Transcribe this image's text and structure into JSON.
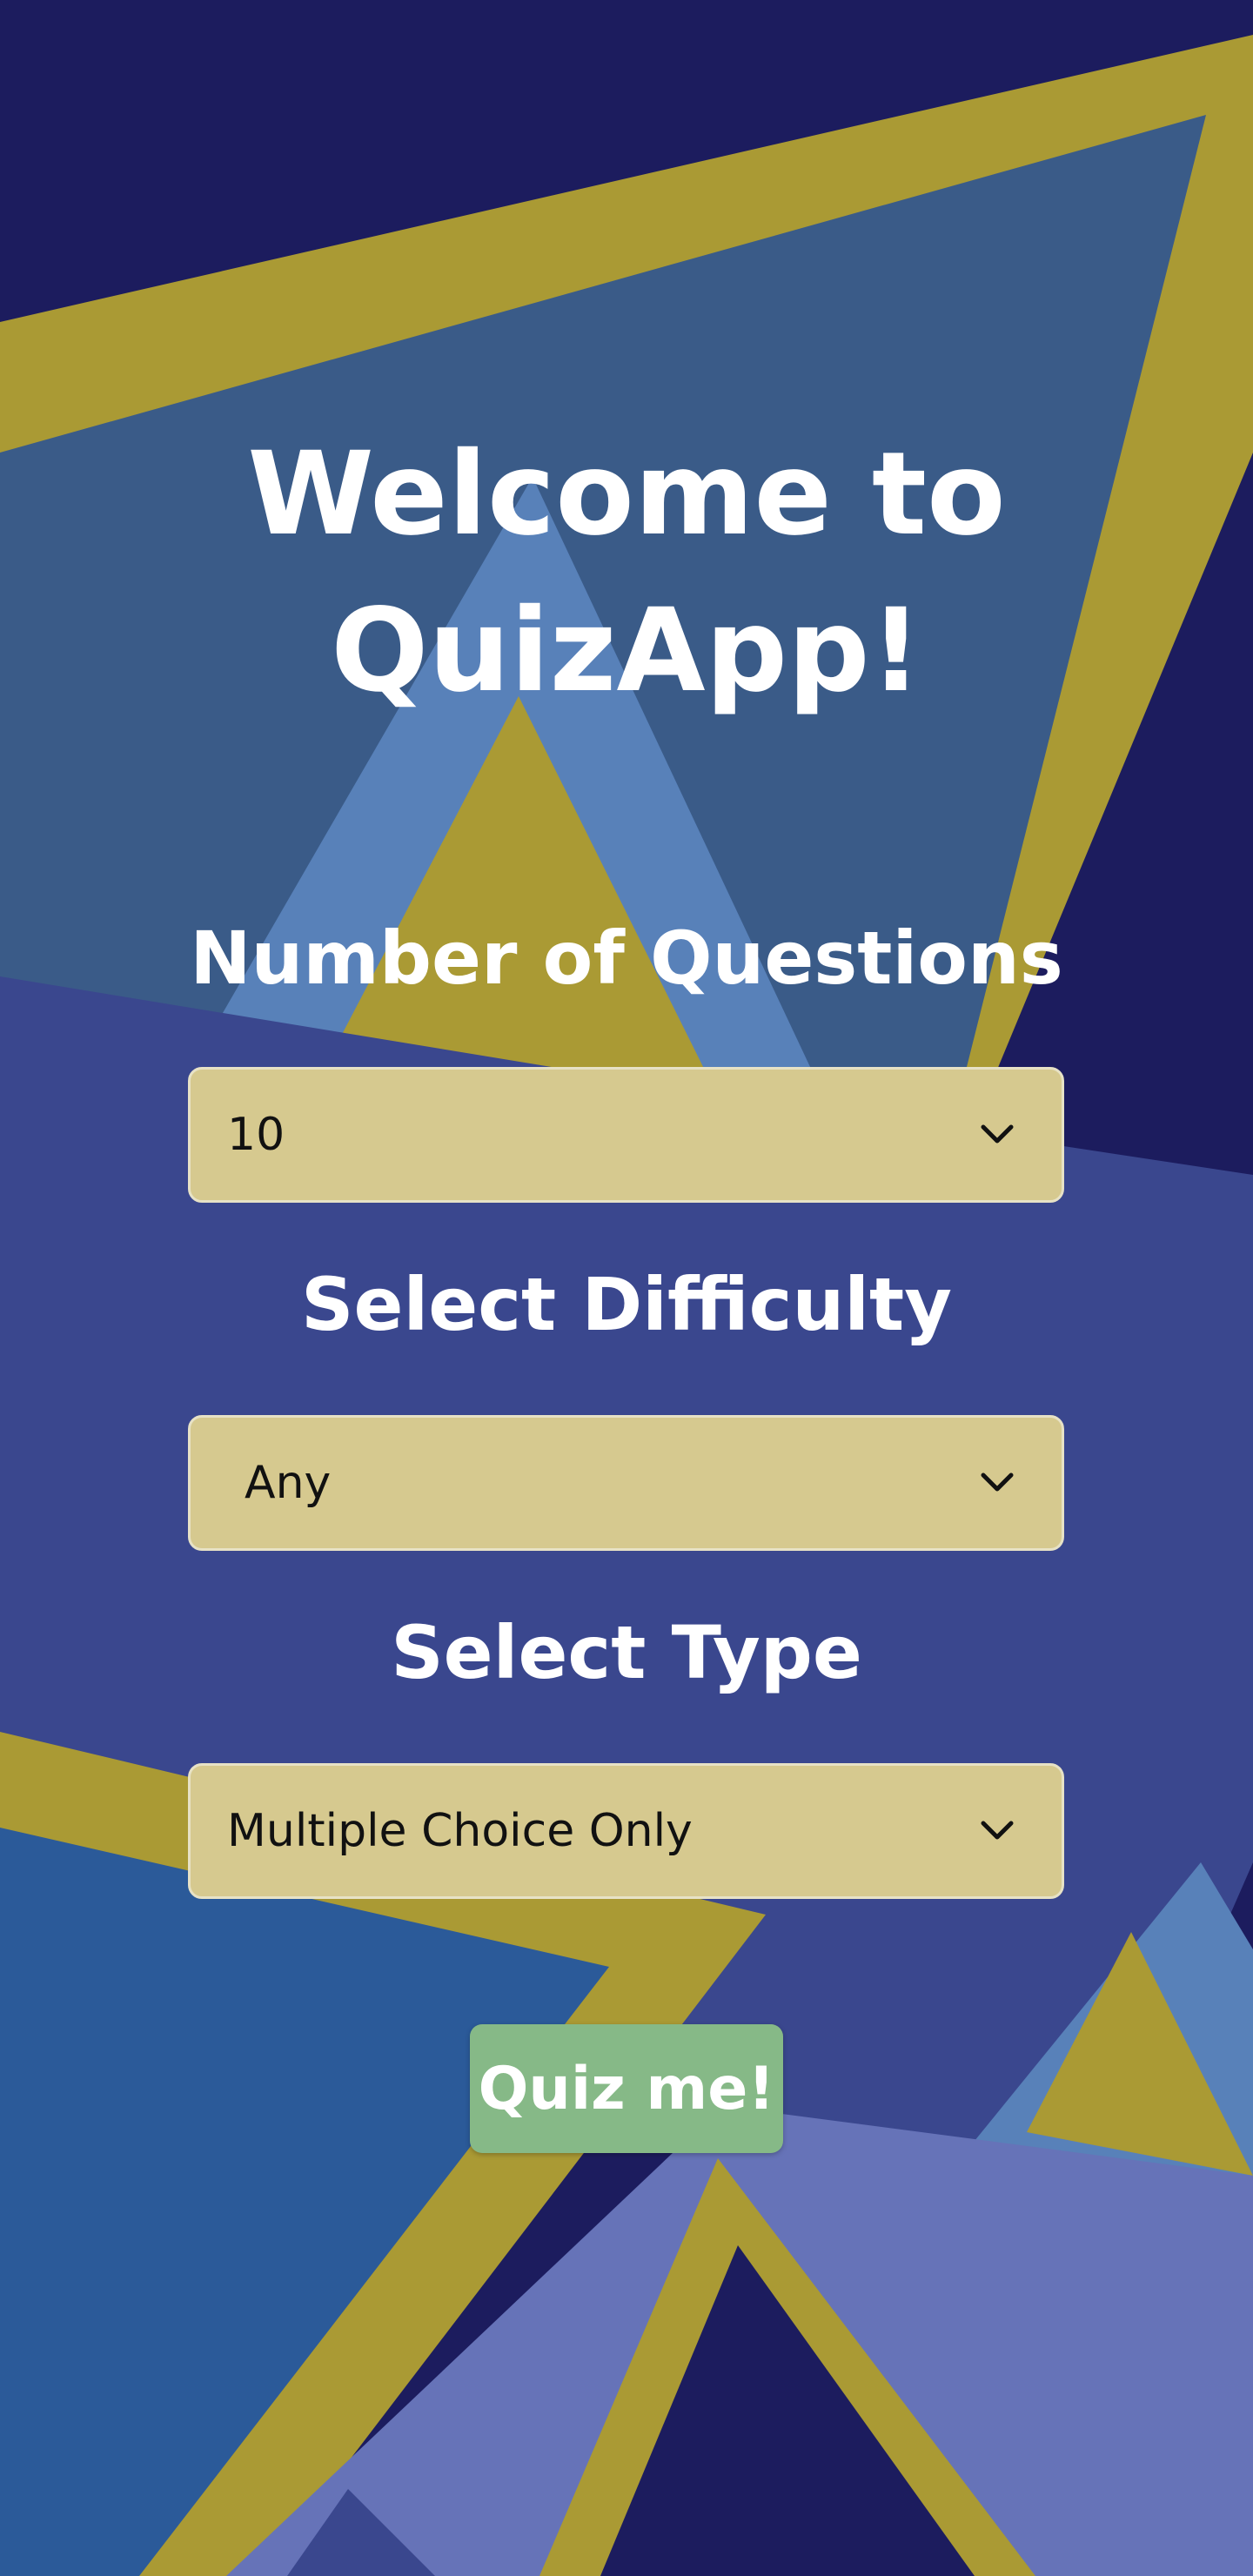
{
  "app": {
    "title_line1": "Welcome to",
    "title_line2": "QuizApp!"
  },
  "form": {
    "questions": {
      "label": "Number of Questions",
      "value": "10"
    },
    "difficulty": {
      "label": "Select Difficulty",
      "value": "Any"
    },
    "type": {
      "label": "Select Type",
      "value": "Multiple Choice Only"
    },
    "submit_label": "Quiz me!"
  },
  "icons": {
    "dropdown": "chevron-down-icon"
  },
  "colors": {
    "navy": "#1c1c5e",
    "gold": "#aa9a34",
    "slate_blue": "#3a5b88",
    "sky_blue": "#5881b9",
    "indigo": "#3a478e",
    "royal_blue": "#2b5a99",
    "periwinkle": "#6673b8",
    "select_bg": "#d6c98f",
    "button_bg": "#86b987",
    "text_white": "#ffffff"
  }
}
